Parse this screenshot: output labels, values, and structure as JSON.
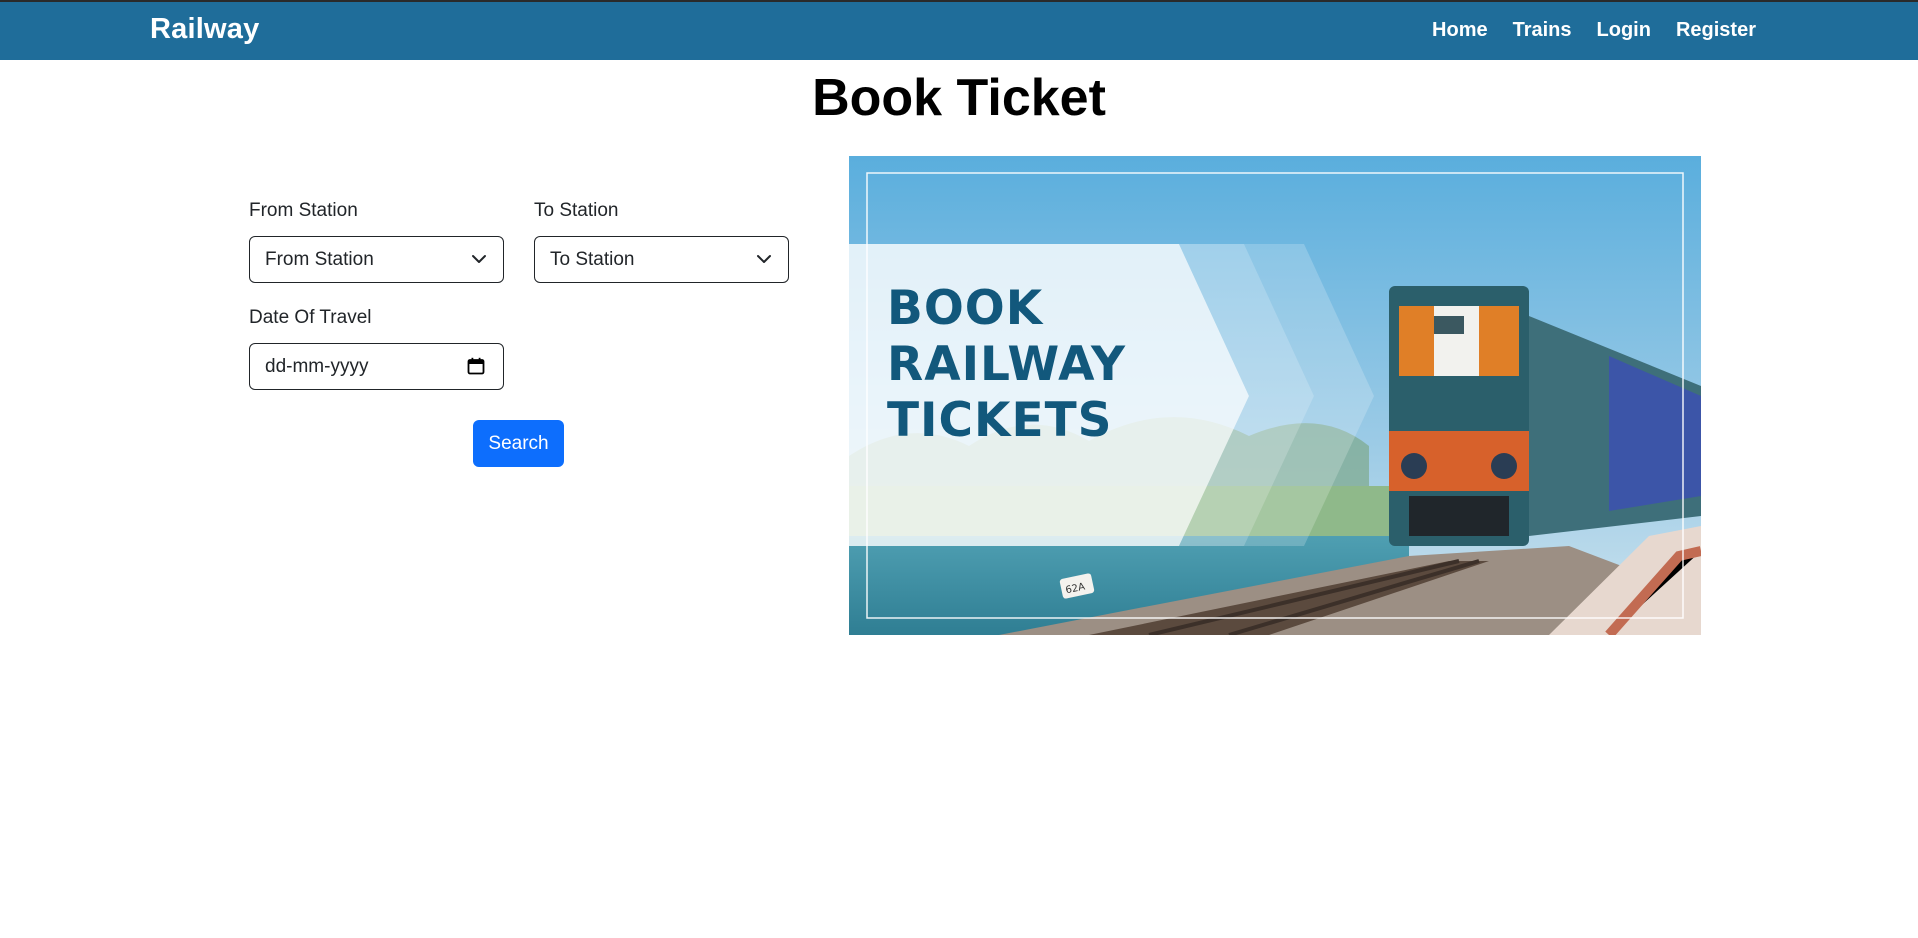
{
  "navbar": {
    "brand": "Railway",
    "links": [
      {
        "label": "Home"
      },
      {
        "label": "Trains"
      },
      {
        "label": "Login"
      },
      {
        "label": "Register"
      }
    ]
  },
  "page": {
    "title": "Book Ticket"
  },
  "form": {
    "from_label": "From Station",
    "from_value": "From Station",
    "to_label": "To Station",
    "to_value": "To Station",
    "date_label": "Date Of Travel",
    "date_placeholder": "dd-mm-yyyy",
    "search_label": "Search"
  },
  "banner": {
    "line1": "BOOK",
    "line2": "RAILWAY",
    "line3": "TICKETS",
    "plate": "62A"
  },
  "colors": {
    "navbar": "#1f6d9a",
    "button": "#0d6efd",
    "banner_text": "#12587c"
  },
  "icons": {
    "select_chevron": "chevron-down-icon",
    "date_picker": "calendar-icon"
  }
}
